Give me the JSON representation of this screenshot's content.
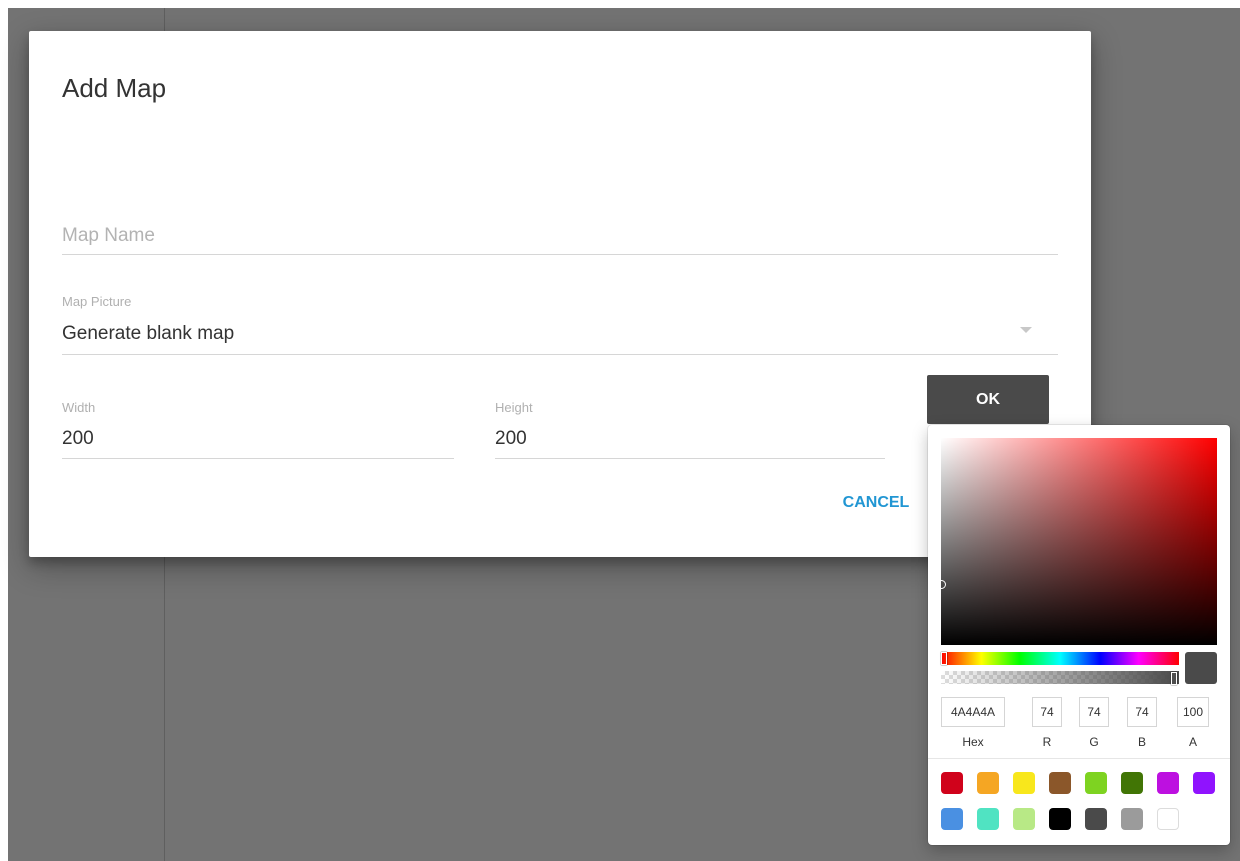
{
  "dialog": {
    "title": "Add Map",
    "map_name": {
      "placeholder": "Map Name",
      "value": ""
    },
    "map_picture": {
      "label": "Map Picture",
      "value": "Generate blank map"
    },
    "width": {
      "label": "Width",
      "value": "200"
    },
    "height": {
      "label": "Height",
      "value": "200"
    },
    "ok_label": "OK",
    "cancel_label": "CANCEL"
  },
  "color_picker": {
    "current_color": "#4A4A4A",
    "hue_color": "#FF0000",
    "alpha_percent": 100,
    "inputs": {
      "hex": "4A4A4A",
      "r": "74",
      "g": "74",
      "b": "74",
      "a": "100"
    },
    "labels": {
      "hex": "Hex",
      "r": "R",
      "g": "G",
      "b": "B",
      "a": "A"
    },
    "preset_colors": [
      "#D0021B",
      "#F5A623",
      "#F8E71C",
      "#8B572A",
      "#7ED321",
      "#417505",
      "#BD10E0",
      "#9013FE",
      "#4A90E2",
      "#50E3C2",
      "#B8E986",
      "#000000",
      "#4A4A4A",
      "#9B9B9B",
      "#FFFFFF"
    ]
  }
}
